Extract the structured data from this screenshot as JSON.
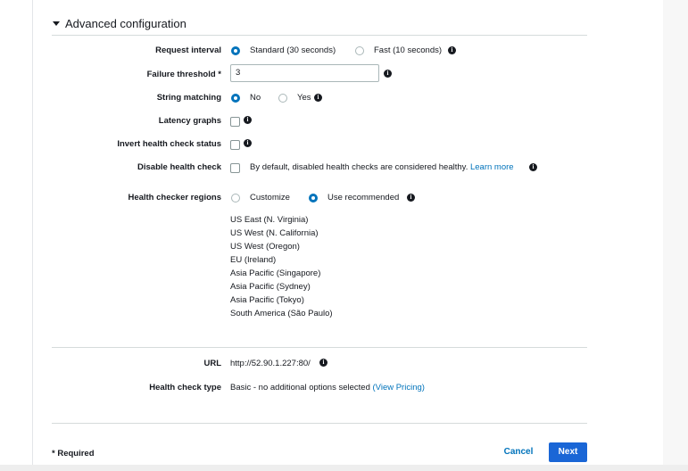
{
  "section": {
    "title": "Advanced configuration"
  },
  "request_interval": {
    "label": "Request interval",
    "options": [
      {
        "label": "Standard (30 seconds)",
        "selected": true
      },
      {
        "label": "Fast (10 seconds)",
        "selected": false
      }
    ]
  },
  "failure_threshold": {
    "label": "Failure threshold *",
    "value": "3"
  },
  "string_matching": {
    "label": "String matching",
    "options": [
      {
        "label": "No",
        "selected": true
      },
      {
        "label": "Yes",
        "selected": false
      }
    ]
  },
  "latency_graphs": {
    "label": "Latency graphs",
    "checked": false
  },
  "invert_status": {
    "label": "Invert health check status",
    "checked": false
  },
  "disable_check": {
    "label": "Disable health check",
    "checked": false,
    "description": "By default, disabled health checks are considered healthy.",
    "link": "Learn more"
  },
  "regions": {
    "label": "Health checker regions",
    "options": [
      {
        "label": "Customize",
        "selected": false
      },
      {
        "label": "Use recommended",
        "selected": true
      }
    ],
    "list": [
      "US East (N. Virginia)",
      "US West (N. California)",
      "US West (Oregon)",
      "EU (Ireland)",
      "Asia Pacific (Singapore)",
      "Asia Pacific (Sydney)",
      "Asia Pacific (Tokyo)",
      "South America (São Paulo)"
    ]
  },
  "url": {
    "label": "URL",
    "value": "http://52.90.1.227:80/"
  },
  "check_type": {
    "label": "Health check type",
    "value": "Basic - no additional options selected",
    "link": "(View Pricing)"
  },
  "footer": {
    "required_note": "* Required",
    "cancel": "Cancel",
    "next": "Next"
  },
  "icons": {
    "info": "i",
    "caret": "caret-down"
  },
  "colors": {
    "accent": "#0073bb",
    "primary_button": "#1a66d6",
    "text": "#16191f"
  }
}
